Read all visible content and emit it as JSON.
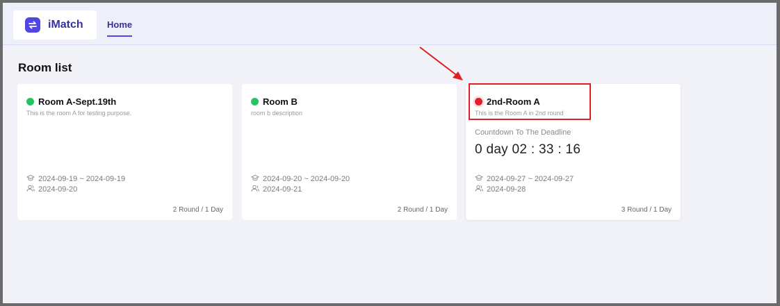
{
  "app": {
    "name": "iMatch"
  },
  "nav": {
    "home_label": "Home"
  },
  "page": {
    "title": "Room list"
  },
  "rooms": [
    {
      "title": "Room A-Sept.19th",
      "description": "This is the room A for testing purpose.",
      "status_color": "#22c55e",
      "period": "2024-09-19 ~ 2024-09-19",
      "result_date": "2024-09-20",
      "rounds": "2 Round / 1 Day"
    },
    {
      "title": "Room B",
      "description": "room b description",
      "status_color": "#22c55e",
      "period": "2024-09-20 ~ 2024-09-20",
      "result_date": "2024-09-21",
      "rounds": "2 Round / 1 Day"
    },
    {
      "title": "2nd-Room A",
      "description": "This is the Room A in 2nd round",
      "status_color": "#e11d2e",
      "countdown_label": "Countdown To The Deadline",
      "countdown_value": "0 day 02 : 33 : 16",
      "period": "2024-09-27 ~ 2024-09-27",
      "result_date": "2024-09-28",
      "rounds": "3 Round / 1 Day"
    }
  ],
  "colors": {
    "brand": "#4f46e5",
    "annotation": "#e02020"
  },
  "icons": [
    "swap-icon",
    "graduation-cap-icon",
    "users-icon"
  ]
}
